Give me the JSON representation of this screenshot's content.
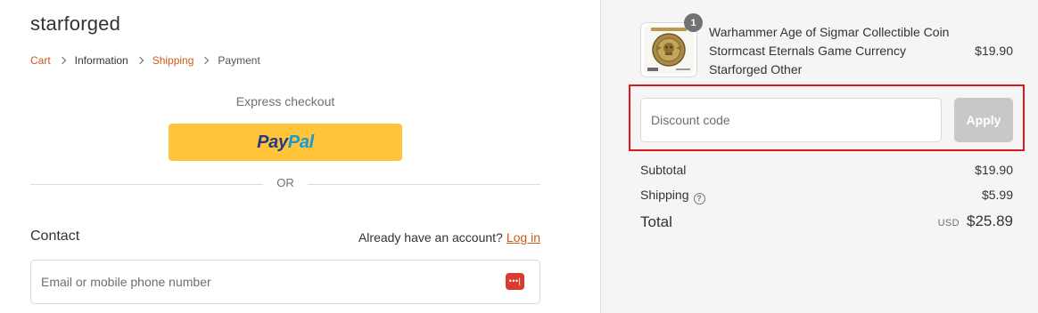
{
  "store": {
    "name": "starforged"
  },
  "breadcrumb": {
    "items": [
      {
        "label": "Cart"
      },
      {
        "label": "Information"
      },
      {
        "label": "Shipping"
      },
      {
        "label": "Payment"
      }
    ]
  },
  "express": {
    "title": "Express checkout",
    "paypal": {
      "part1": "Pay",
      "part2": "Pal"
    },
    "divider_label": "OR"
  },
  "contact": {
    "title": "Contact",
    "account_prompt": "Already have an account?",
    "login_label": "Log in",
    "email_placeholder": "Email or mobile phone number",
    "password_manager_icon": "password-manager-icon"
  },
  "order": {
    "product": {
      "name": "Warhammer Age of Sigmar Collectible Coin Stormcast Eternals Game Currency Starforged Other",
      "price": "$19.90",
      "quantity": "1"
    },
    "discount": {
      "placeholder": "Discount code",
      "apply_label": "Apply"
    },
    "summary": {
      "subtotal_label": "Subtotal",
      "subtotal_value": "$19.90",
      "shipping_label": "Shipping",
      "shipping_value": "$5.99",
      "total_label": "Total",
      "currency": "USD",
      "total_value": "$25.89"
    }
  },
  "colors": {
    "link": "#cc5a1e",
    "paypal_button": "#ffc43a",
    "highlight": "#e0161d",
    "apply_disabled": "#c8c8c8",
    "sidebar_bg": "#f5f5f5"
  }
}
